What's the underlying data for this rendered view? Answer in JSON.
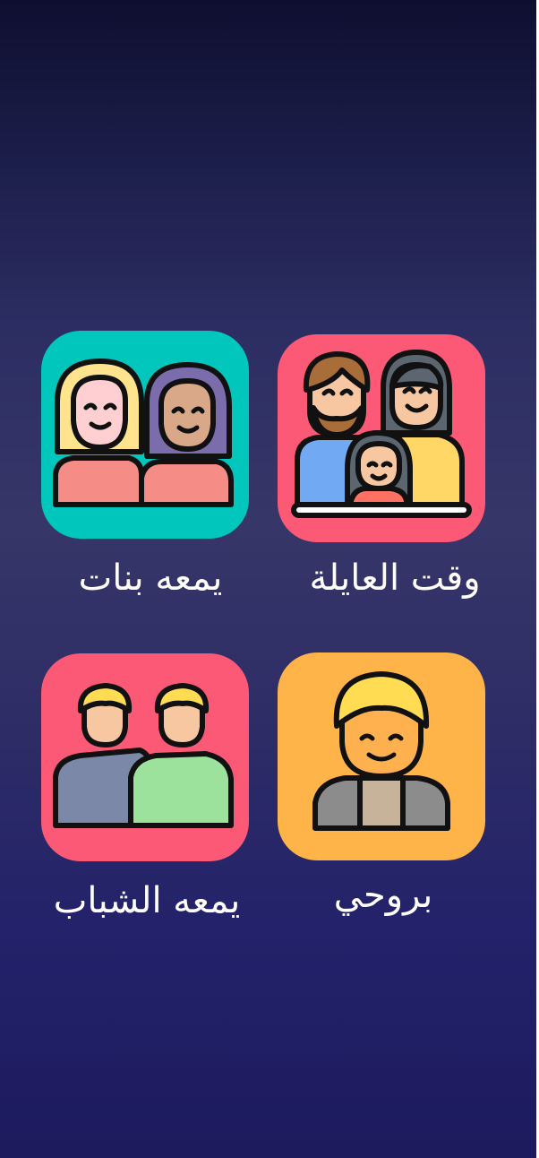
{
  "categories": [
    {
      "id": "family",
      "label": "وقت العايلة",
      "tile_color": "#fc5977",
      "icon": "family-icon"
    },
    {
      "id": "girls",
      "label": "يمعه بنات",
      "tile_color": "#00c6bc",
      "icon": "two-women-icon"
    },
    {
      "id": "solo",
      "label": "بروحي",
      "tile_color": "#ffb44a",
      "icon": "single-man-icon"
    },
    {
      "id": "guys",
      "label": "يمعه الشباب",
      "tile_color": "#fc5977",
      "icon": "two-men-icon"
    }
  ]
}
